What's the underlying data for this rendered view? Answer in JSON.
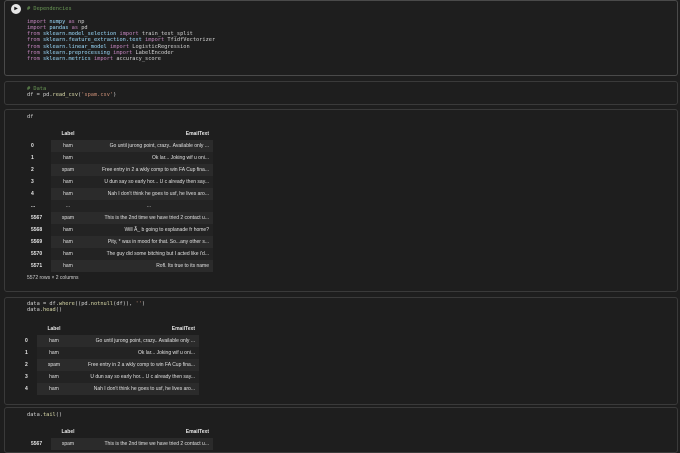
{
  "cell1": {
    "run_glyph": "▶",
    "lines": [
      {
        "type": "comment",
        "text": "# Dependencies"
      },
      {
        "type": "blank",
        "text": ""
      },
      {
        "type": "import",
        "a": "import",
        "b": " numpy ",
        "c": "as",
        "d": " np"
      },
      {
        "type": "import",
        "a": "import",
        "b": " pandas ",
        "c": "as",
        "d": " pd"
      },
      {
        "type": "from",
        "a": "from",
        "b": " sklearn.model_selection ",
        "c": "import",
        "d": " train_test_split"
      },
      {
        "type": "from",
        "a": "from",
        "b": " sklearn.feature_extraction.text ",
        "c": "import",
        "d": " TfidfVectorizer"
      },
      {
        "type": "from",
        "a": "from",
        "b": " sklearn.linear_model ",
        "c": "import",
        "d": " LogisticRegression"
      },
      {
        "type": "from",
        "a": "from",
        "b": " sklearn.preprocessing ",
        "c": "import",
        "d": " LabelEncoder"
      },
      {
        "type": "from",
        "a": "from",
        "b": " sklearn.metrics ",
        "c": "import",
        "d": " accuracy_score"
      }
    ]
  },
  "cell2": {
    "comment": "# Data",
    "code_a": "df = pd.",
    "code_fn": "read_csv",
    "code_b": "(",
    "code_str": "'spam.csv'",
    "code_c": ")"
  },
  "cell3": {
    "code": "df",
    "columns": [
      "Label",
      "EmailText"
    ],
    "rows": [
      {
        "idx": "0",
        "label": "ham",
        "text": "Go until jurong point, crazy.. Available only ..."
      },
      {
        "idx": "1",
        "label": "ham",
        "text": "Ok lar... Joking wif u oni..."
      },
      {
        "idx": "2",
        "label": "spam",
        "text": "Free entry in 2 a wkly comp to win FA Cup fina..."
      },
      {
        "idx": "3",
        "label": "ham",
        "text": "U dun say so early hor... U c already then say..."
      },
      {
        "idx": "4",
        "label": "ham",
        "text": "Nah I don't think he goes to usf, he lives aro..."
      },
      {
        "idx": "...",
        "label": "...",
        "text": "..."
      },
      {
        "idx": "5567",
        "label": "spam",
        "text": "This is the 2nd time we have tried 2 contact u..."
      },
      {
        "idx": "5568",
        "label": "ham",
        "text": "Will Ã_ b going to esplanade fr home?"
      },
      {
        "idx": "5569",
        "label": "ham",
        "text": "Pity, * was in mood for that. So...any other s..."
      },
      {
        "idx": "5570",
        "label": "ham",
        "text": "The guy did some bitching but I acted like i'd..."
      },
      {
        "idx": "5571",
        "label": "ham",
        "text": "Rofl. Its true to its name"
      }
    ],
    "caption": "5572 rows × 2 columns"
  },
  "cell4": {
    "line1_a": "data = df.",
    "line1_fn": "where",
    "line1_b": "((pd.",
    "line1_fn2": "notnull",
    "line1_c": "(df)), ",
    "line1_str": "''",
    "line1_d": ")",
    "line2_a": "data.",
    "line2_fn": "head",
    "line2_b": "()",
    "columns": [
      "Label",
      "EmailText"
    ],
    "rows": [
      {
        "idx": "0",
        "label": "ham",
        "text": "Go until jurong point, crazy.. Available only ..."
      },
      {
        "idx": "1",
        "label": "ham",
        "text": "Ok lar... Joking wif u oni..."
      },
      {
        "idx": "2",
        "label": "spam",
        "text": "Free entry in 2 a wkly comp to win FA Cup fina..."
      },
      {
        "idx": "3",
        "label": "ham",
        "text": "U dun say so early hor... U c already then say..."
      },
      {
        "idx": "4",
        "label": "ham",
        "text": "Nah I don't think he goes to usf, he lives aro..."
      }
    ]
  },
  "cell5": {
    "code_a": "data.",
    "code_fn": "tail",
    "code_b": "()",
    "columns": [
      "Label",
      "EmailText"
    ],
    "rows": [
      {
        "idx": "5567",
        "label": "spam",
        "text": "This is the 2nd time we have tried 2 contact u..."
      }
    ]
  }
}
